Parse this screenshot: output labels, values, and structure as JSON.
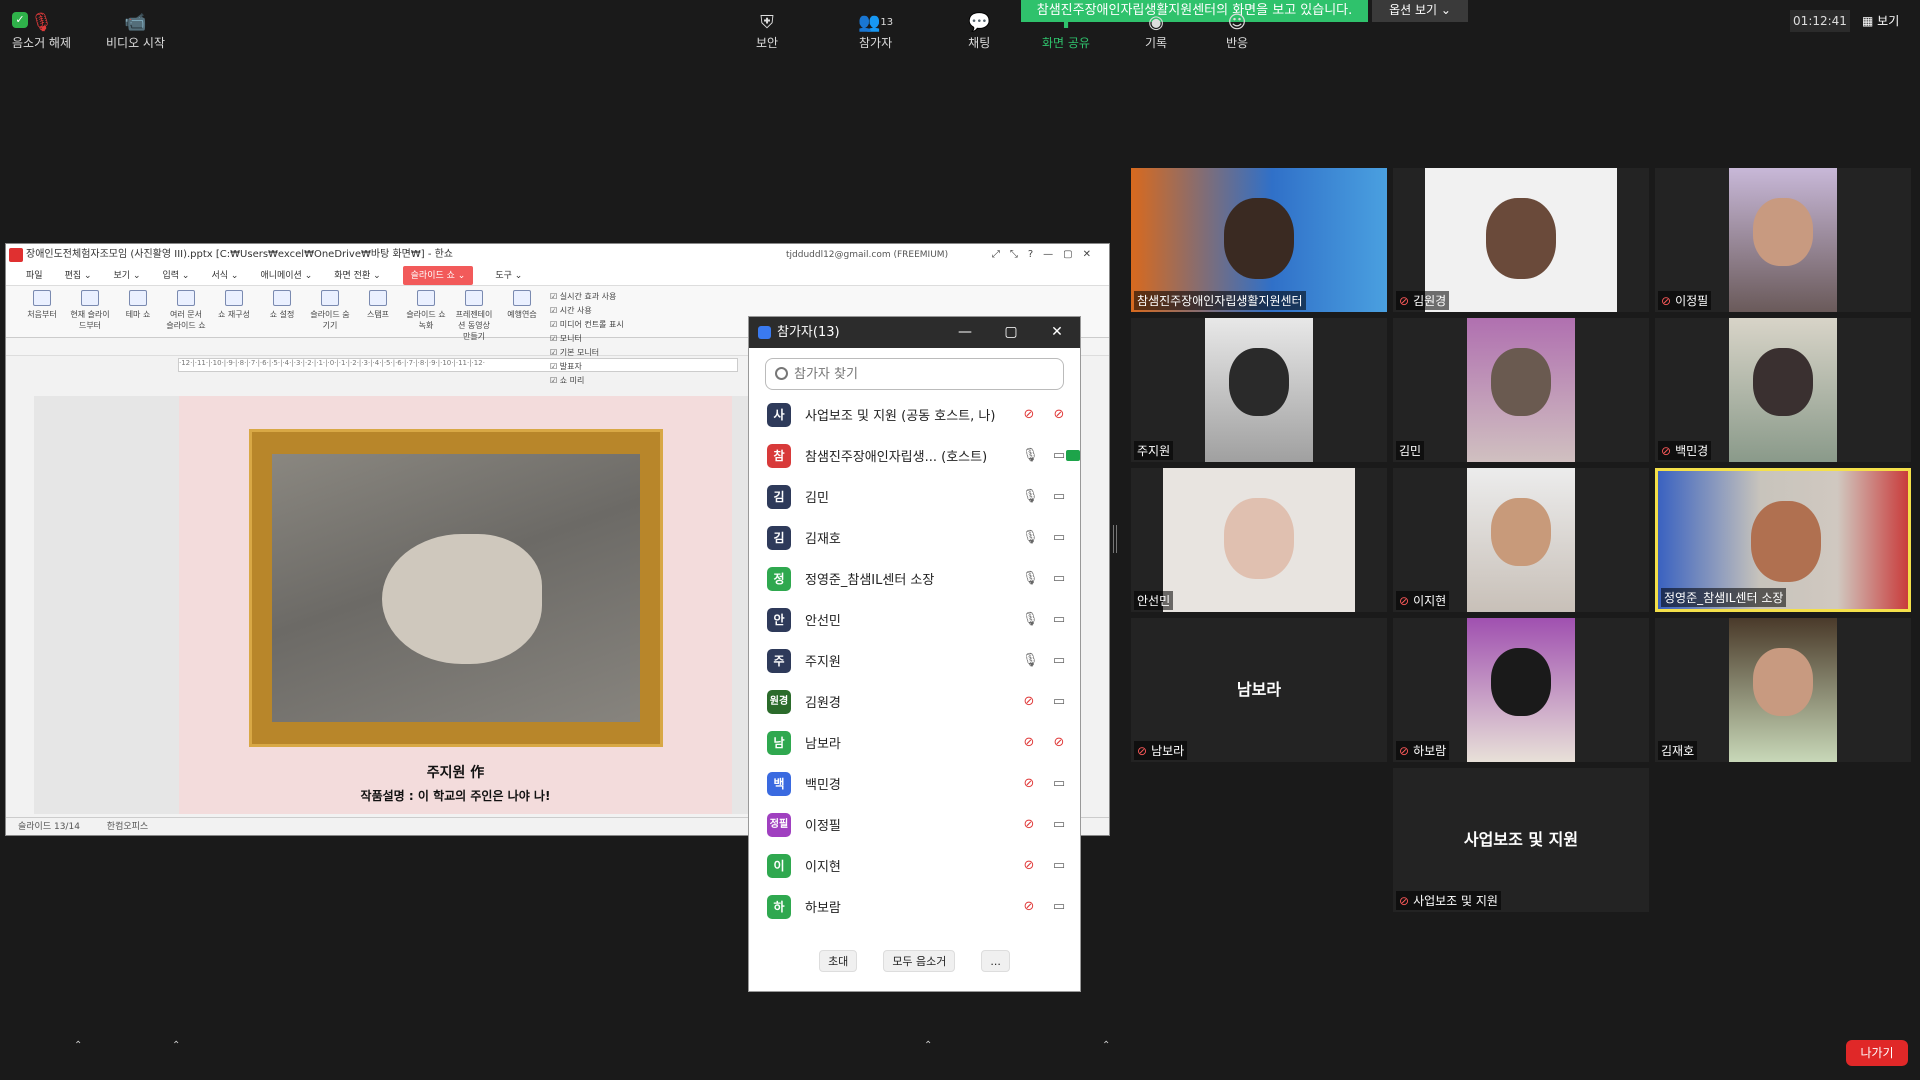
{
  "share_banner": "참샘진주장애인자립생활지원센터의 화면을 보고 있습니다.",
  "view_options": "옵션 보기 ⌄",
  "clock": "01:12:41",
  "view_label": "보기",
  "doc": {
    "title": "장애인도전체험자조모임 (사진활영 III).pptx [C:₩Users₩excel₩OneDrive₩바탕 화면₩] - 한쇼",
    "account": "tjdduddl12@gmail.com (FREEMIUM)",
    "menu": [
      "파일",
      "편집 ⌄",
      "보기 ⌄",
      "입력 ⌄",
      "서식 ⌄",
      "애니메이션 ⌄",
      "화면 전환 ⌄",
      "슬라이드 쇼 ⌄",
      "도구 ⌄"
    ],
    "ribbon": [
      "처음부터",
      "현재 슬라이드부터",
      "테마 쇼",
      "여러 문서 슬라이드 쇼",
      "쇼 재구성",
      "쇼 설정",
      "슬라이드 숨기기",
      "스탬프",
      "슬라이드 쇼 녹화",
      "프레젠테이션 동영상 만들기",
      "예행연습"
    ],
    "ribbon_checks": [
      "실시간 효과 사용",
      "시간 사용",
      "미디어 컨트롤 표시",
      "모니터",
      "기본 모니터",
      "발표자",
      "쇼 미리"
    ],
    "slide_caption1": "주지원 作",
    "slide_caption2": "작품설명 : 이 학교의 주인은 나야 나!",
    "status_slide": "슬라이드 13/14",
    "status_app": "한컴오피스"
  },
  "participants_panel": {
    "title": "참가자(13)",
    "search_placeholder": "참가자 찾기",
    "items": [
      {
        "avatar": "사",
        "color": "#2e3a5a",
        "name": "사업보조 및 지원 (공동 호스트, 나)"
      },
      {
        "avatar": "참",
        "color": "#d83a3a",
        "name": "참샘진주장애인자립생... (호스트)"
      },
      {
        "avatar": "김",
        "color": "#2e3a5a",
        "name": "김민"
      },
      {
        "avatar": "김",
        "color": "#2e3a5a",
        "name": "김재호"
      },
      {
        "avatar": "정",
        "color": "#2fa84f",
        "name": "정영준_참샘IL센터 소장"
      },
      {
        "avatar": "안",
        "color": "#2e3a5a",
        "name": "안선민"
      },
      {
        "avatar": "주",
        "color": "#2e3a5a",
        "name": "주지원"
      },
      {
        "avatar": "원경",
        "color": "#2b6b2b",
        "name": "김원경"
      },
      {
        "avatar": "남",
        "color": "#2fa84f",
        "name": "남보라"
      },
      {
        "avatar": "백",
        "color": "#3a6ae0",
        "name": "백민경"
      },
      {
        "avatar": "정필",
        "color": "#a040c0",
        "name": "이정필"
      },
      {
        "avatar": "이",
        "color": "#2fa84f",
        "name": "이지현"
      },
      {
        "avatar": "하",
        "color": "#2fa84f",
        "name": "하보람"
      }
    ],
    "invite": "초대",
    "mute_all": "모두 음소거",
    "more": "..."
  },
  "tiles": [
    {
      "name": "참샘진주장애인자립생활지원센터"
    },
    {
      "name": "김원경"
    },
    {
      "name": "이정필"
    },
    {
      "name": "주지원"
    },
    {
      "name": "김민"
    },
    {
      "name": "백민경"
    },
    {
      "name": "안선민"
    },
    {
      "name": "이지현"
    },
    {
      "name": "정영준_참샘IL센터 소장"
    },
    {
      "name": "남보라",
      "big": "남보라"
    },
    {
      "name": "하보람"
    },
    {
      "name": "김재호"
    },
    {
      "name": "사업보조 및 지원",
      "big": "사업보조 및 지원"
    }
  ],
  "toolbar": {
    "unmute": "음소거 해제",
    "start_video": "비디오 시작",
    "security": "보안",
    "participants": "참가자",
    "participants_count": "13",
    "chat": "채팅",
    "share_screen": "화면 공유",
    "record": "기록",
    "reactions": "반응",
    "leave": "나가기"
  }
}
